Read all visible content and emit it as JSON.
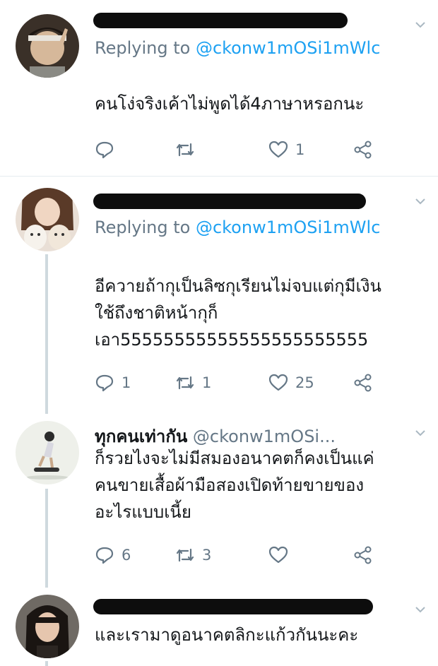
{
  "tweets": [
    {
      "replying_prefix": "Replying to ",
      "replying_handle": "@ckonw1mOSi1mWlc",
      "text": "คนโง่จริงเค้าไม่พูดได้4ภาษาหรอกนะ",
      "reply_count": "",
      "retweet_count": "",
      "like_count": "1"
    },
    {
      "replying_prefix": "Replying to ",
      "replying_handle": "@ckonw1mOSi1mWlc",
      "text_lines": [
        "อีควายถ้ากุเป็นลิซกุเรียนไม่จบแต่กุมีเงิน",
        "ใช้ถึงชาติหน้ากุก็",
        "เอา55555555555555555555555"
      ],
      "reply_count": "1",
      "retweet_count": "1",
      "like_count": "25"
    },
    {
      "display_name": "ทุกคนเท่ากัน",
      "handle": "@ckonw1mOSi...",
      "text_lines": [
        "ก็รวยไงจะไม่มีสมองอนาคตก็คงเป็นแค่",
        "คนขายเสื้อผ้ามือสองเปิดท้ายขายของ",
        "อะไรแบบเนี้ย"
      ],
      "reply_count": "6",
      "retweet_count": "3",
      "like_count": ""
    },
    {
      "text": "และเรามาดูอนาคตลิกะแก้วกันนะคะ"
    }
  ],
  "colors": {
    "accent": "#1da1f2",
    "secondary_text": "#657786",
    "redaction": "#0d0d0d"
  },
  "icons": [
    "reply-icon",
    "retweet-icon",
    "like-icon",
    "share-icon",
    "chevron-down-icon"
  ]
}
